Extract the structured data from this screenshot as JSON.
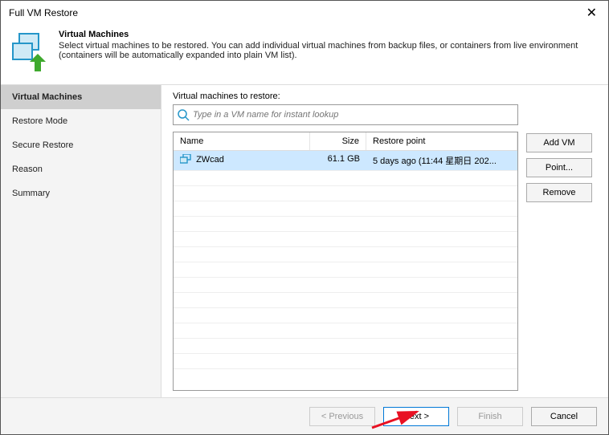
{
  "window": {
    "title": "Full VM Restore"
  },
  "header": {
    "title": "Virtual Machines",
    "desc": "Select virtual machines to be restored. You can add individual virtual machines from backup files, or containers from live environment (containers will be automatically expanded into plain VM list)."
  },
  "sidebar": {
    "items": [
      {
        "label": "Virtual Machines",
        "active": true
      },
      {
        "label": "Restore Mode"
      },
      {
        "label": "Secure Restore"
      },
      {
        "label": "Reason"
      },
      {
        "label": "Summary"
      }
    ]
  },
  "main": {
    "section_label": "Virtual machines to restore:",
    "search_placeholder": "Type in a VM name for instant lookup",
    "columns": {
      "name": "Name",
      "size": "Size",
      "rp": "Restore point"
    },
    "rows": [
      {
        "name": "ZWcad",
        "size": "61.1 GB",
        "rp": "5 days ago (11:44 星期日 202..."
      }
    ],
    "buttons": {
      "add": "Add VM",
      "point": "Point...",
      "remove": "Remove"
    }
  },
  "footer": {
    "previous": "< Previous",
    "next": "Next >",
    "finish": "Finish",
    "cancel": "Cancel"
  }
}
